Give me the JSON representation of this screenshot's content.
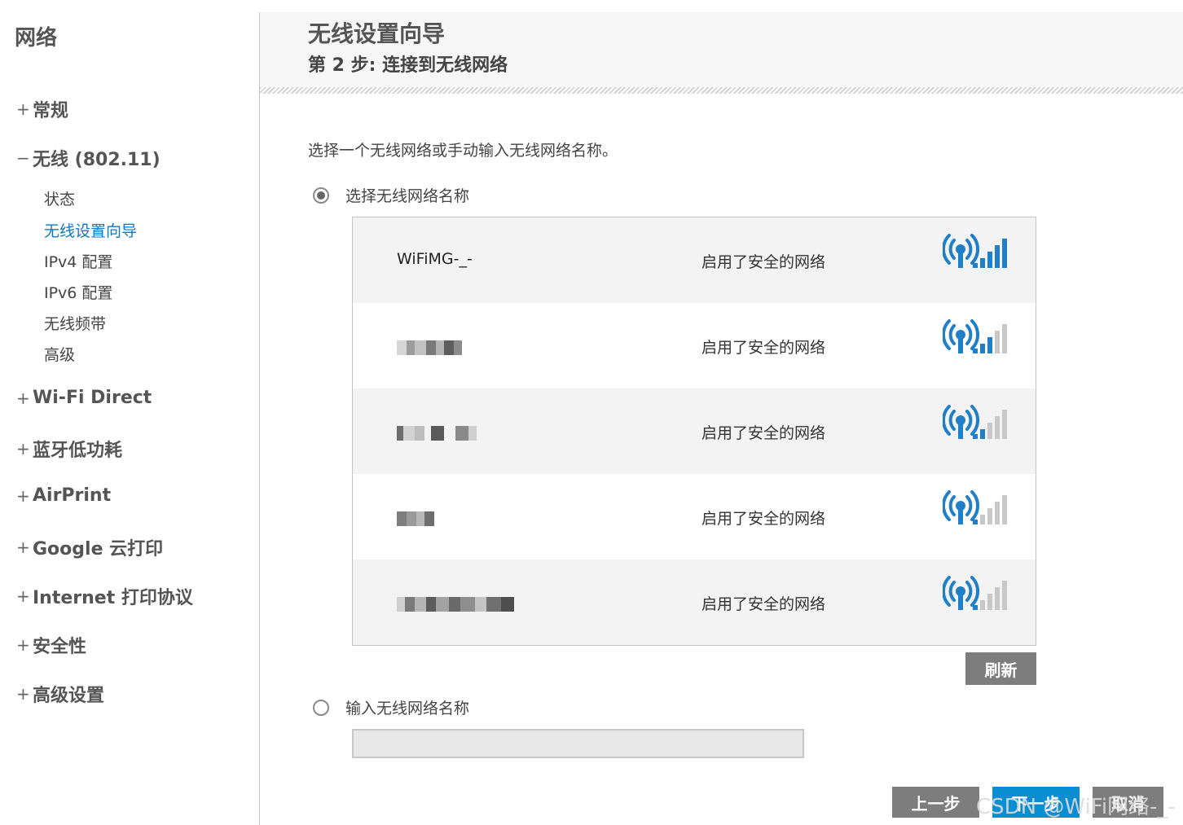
{
  "sidebar": {
    "title": "网络",
    "sections": [
      {
        "sign": "+",
        "label": "常规"
      },
      {
        "sign": "−",
        "label": "无线 (802.11)"
      },
      {
        "sign": "+",
        "label": "Wi-Fi Direct"
      },
      {
        "sign": "+",
        "label": "蓝牙低功耗"
      },
      {
        "sign": "+",
        "label": "AirPrint"
      },
      {
        "sign": "+",
        "label": "Google 云打印"
      },
      {
        "sign": "+",
        "label": "Internet 打印协议"
      },
      {
        "sign": "+",
        "label": "安全性"
      },
      {
        "sign": "+",
        "label": "高级设置"
      }
    ],
    "wireless_items": [
      {
        "label": "状态"
      },
      {
        "label": "无线设置向导",
        "active": true
      },
      {
        "label": "IPv4 配置"
      },
      {
        "label": "IPv6 配置"
      },
      {
        "label": "无线频带"
      },
      {
        "label": "高级"
      }
    ]
  },
  "header": {
    "title": "无线设置向导",
    "step": "第 2 步: 连接到无线网络"
  },
  "main": {
    "instruction": "选择一个无线网络或手动输入无线网络名称。",
    "option_select_label": "选择无线网络名称",
    "option_manual_label": "输入无线网络名称",
    "manual_input_value": "",
    "networks": [
      {
        "ssid": "WiFiMG-_-",
        "security": "启用了安全的网络",
        "signal_bars": 4
      },
      {
        "ssid": "",
        "security": "启用了安全的网络",
        "signal_bars": 2
      },
      {
        "ssid": "",
        "security": "启用了安全的网络",
        "signal_bars": 1
      },
      {
        "ssid": "",
        "security": "启用了安全的网络",
        "signal_bars": 0
      },
      {
        "ssid": "",
        "security": "启用了安全的网络",
        "signal_bars": 0
      }
    ],
    "refresh_label": "刷新",
    "prev_label": "上一步",
    "next_label": "下一步",
    "cancel_label": "取消"
  },
  "watermark": "CSDN @WiFi网络-_-",
  "colors": {
    "accent": "#0b79c4",
    "signal_blue": "#1f7fc8",
    "signal_gray": "#c8c8c8",
    "button_gray": "#7d7d7d",
    "button_blue": "#0b8ed1"
  }
}
